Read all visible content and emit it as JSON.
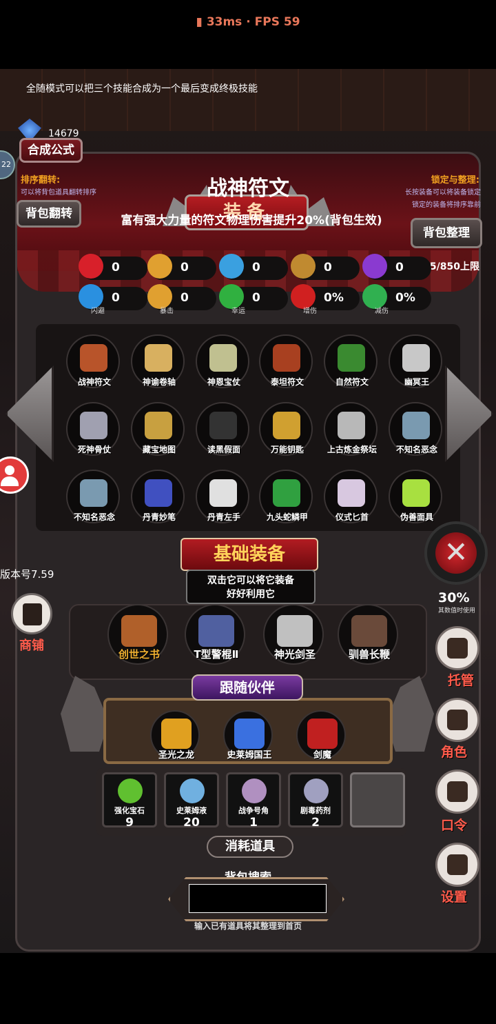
{
  "status": {
    "ping": "33ms",
    "fps": "FPS 59",
    "sep": "·"
  },
  "tip": "全随模式可以把三个技能合成为一个最后变成终极技能",
  "gold": "14679",
  "side_circle": "22",
  "buttons": {
    "synth": "合成公式",
    "flip": "背包翻转",
    "organize": "背包整理"
  },
  "sort": {
    "title": "排序翻转:",
    "sub": "可以将背包道具翻转排序"
  },
  "lock": {
    "title": "锁定与整理:",
    "sub1": "长按装备可以将装备锁定",
    "sub2": "锁定的装备将排序靠前"
  },
  "panel_title": "装备",
  "item": {
    "name": "战神符文",
    "desc": "富有强大力量的符文物理伤害提升20%(背包生效)"
  },
  "capacity": "25/850上限",
  "stats": [
    {
      "icon": "heart-icon",
      "value": "0",
      "label": "",
      "color": "#d8202a"
    },
    {
      "icon": "strength-icon",
      "value": "0",
      "label": "",
      "color": "#e0a030"
    },
    {
      "icon": "helmet-icon",
      "value": "0",
      "label": "",
      "color": "#3aa0e0"
    },
    {
      "icon": "sword-icon",
      "value": "0",
      "label": "",
      "color": "#c08a30"
    },
    {
      "icon": "lightning-icon",
      "value": "0",
      "label": "",
      "color": "#8a3ad0"
    },
    {
      "icon": "boot-icon",
      "value": "0",
      "label": "闪避",
      "color": "#2a90e0"
    },
    {
      "icon": "crit-icon",
      "value": "0",
      "label": "暴击",
      "color": "#e0a030"
    },
    {
      "icon": "clover-icon",
      "value": "0",
      "label": "幸运",
      "color": "#30b040"
    },
    {
      "icon": "crossed-swords-icon",
      "value": "0%",
      "label": "增伤",
      "color": "#d02020"
    },
    {
      "icon": "shield-icon",
      "value": "0%",
      "label": "减伤",
      "color": "#30b050"
    }
  ],
  "inventory": [
    {
      "name": "战神符文",
      "color": "#b8542a"
    },
    {
      "name": "神谕卷轴",
      "color": "#d8b060"
    },
    {
      "name": "神恩宝仗",
      "color": "#c0c090"
    },
    {
      "name": "泰坦符文",
      "color": "#a84020"
    },
    {
      "name": "自然符文",
      "color": "#3a8a30"
    },
    {
      "name": "幽冥王",
      "color": "#c8c8c8"
    },
    {
      "name": "死神骨仗",
      "color": "#a0a0b0"
    },
    {
      "name": "藏宝地图",
      "color": "#c8a040"
    },
    {
      "name": "读黑假面",
      "color": "#333333"
    },
    {
      "name": "万能钥匙",
      "color": "#d0a030"
    },
    {
      "name": "上古炼金祭坛",
      "color": "#b8b8b8"
    },
    {
      "name": "不知名恶念",
      "color": "#7a9ab0"
    },
    {
      "name": "不知名恶念",
      "color": "#7a9ab0"
    },
    {
      "name": "丹青妙笔",
      "color": "#4050c0"
    },
    {
      "name": "丹青左手",
      "color": "#e0e0e0"
    },
    {
      "name": "九头蛇鳞甲",
      "color": "#30a040"
    },
    {
      "name": "仪式匕首",
      "color": "#d8c8e0"
    },
    {
      "name": "伪善面具",
      "color": "#a8e040"
    }
  ],
  "version": "版本号7.59",
  "base": {
    "title": "基础装备",
    "tip1": "双击它可以将它装备",
    "tip2": "好好利用它"
  },
  "equipped": [
    {
      "name": "创世之书",
      "color": "#b0602a",
      "highlight": true
    },
    {
      "name": "T型警棍Ⅱ",
      "color": "#5060a0",
      "highlight": false
    },
    {
      "name": "神光剑圣",
      "color": "#c0c0c0",
      "highlight": false
    },
    {
      "name": "驯兽长鞭",
      "color": "#6a4a3a",
      "highlight": false
    }
  ],
  "follow": {
    "title": "跟随伙伴",
    "items": [
      {
        "name": "圣光之龙",
        "color": "#e0a020"
      },
      {
        "name": "史莱姆国王",
        "color": "#3a70e0"
      },
      {
        "name": "剑魔",
        "color": "#c02020"
      }
    ]
  },
  "consumables": {
    "title": "消耗道具",
    "items": [
      {
        "name": "强化宝石",
        "count": "9",
        "color": "#60c030"
      },
      {
        "name": "史莱姆液",
        "count": "20",
        "color": "#70b0e0"
      },
      {
        "name": "战争号角",
        "count": "1",
        "color": "#b090c0"
      },
      {
        "name": "剧毒药剂",
        "count": "2",
        "color": "#a0a0c0"
      }
    ]
  },
  "search": {
    "label": "背包搜索",
    "hint": "输入已有道具将其整理到首页",
    "value": ""
  },
  "percent": "30%",
  "percent_sub": "其数值时使用",
  "side": {
    "shop": "商铺",
    "manage": "托管",
    "role": "角色",
    "code": "口令",
    "settings": "设置"
  },
  "close_symbol": "✕"
}
